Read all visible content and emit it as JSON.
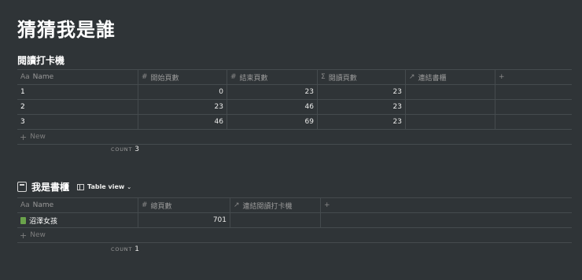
{
  "page": {
    "title": "猜猜我是誰"
  },
  "db1": {
    "title": "閱讀打卡機",
    "headers": [
      {
        "icon": "Aa",
        "label": "Name"
      },
      {
        "icon": "#",
        "label": "開始頁數"
      },
      {
        "icon": "#",
        "label": "結束頁數"
      },
      {
        "icon": "Σ",
        "label": "閱讀頁數"
      },
      {
        "icon": "↗",
        "label": "連結書櫃"
      },
      {
        "icon": "+",
        "label": ""
      }
    ],
    "rows": [
      {
        "name": "1",
        "start": "0",
        "end": "23",
        "read": "23"
      },
      {
        "name": "2",
        "start": "23",
        "end": "46",
        "read": "23"
      },
      {
        "name": "3",
        "start": "46",
        "end": "69",
        "read": "23"
      }
    ],
    "new_label": "New",
    "count_label": "COUNT",
    "count_value": "3"
  },
  "db2": {
    "title": "我是書櫃",
    "view_label": "Table view",
    "headers": [
      {
        "icon": "Aa",
        "label": "Name"
      },
      {
        "icon": "#",
        "label": "總頁數"
      },
      {
        "icon": "↗",
        "label": "連結閱讀打卡機"
      },
      {
        "icon": "+",
        "label": ""
      }
    ],
    "rows": [
      {
        "name": "沼澤女孩",
        "pages": "701"
      }
    ],
    "new_label": "New",
    "count_label": "COUNT",
    "count_value": "1"
  }
}
